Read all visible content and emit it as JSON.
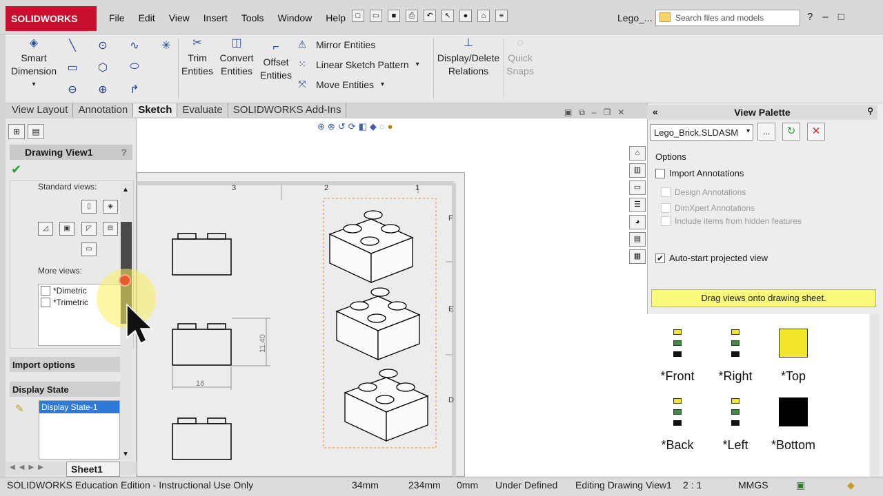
{
  "app": {
    "logo_text": "SOLIDWORKS",
    "doc_title": "Lego_..."
  },
  "menu": [
    "File",
    "Edit",
    "View",
    "Insert",
    "Tools",
    "Window",
    "Help"
  ],
  "search": {
    "placeholder": "Search files and models"
  },
  "ribbon": {
    "smart_dimension": "Smart Dimension",
    "trim_entities": "Trim Entities",
    "convert_entities": "Convert Entities",
    "offset_entities": "Offset Entities",
    "mirror_entities": "Mirror Entities",
    "linear_sketch_pattern": "Linear Sketch Pattern",
    "move_entities": "Move Entities",
    "display_delete_relations": "Display/Delete Relations",
    "quick_snaps": "Quick Snaps"
  },
  "tabs": [
    "View Layout",
    "Annotation",
    "Sketch",
    "Evaluate",
    "SOLIDWORKS Add-Ins"
  ],
  "active_tab": "Sketch",
  "property_manager": {
    "title": "Drawing View1",
    "help": "?",
    "standard_views_label": "Standard views:",
    "more_views_label": "More views:",
    "more_views": [
      "*Dimetric",
      "*Trimetric"
    ],
    "import_options": "Import options",
    "display_state_header": "Display State",
    "display_state_item": "Display State-1"
  },
  "sheet_tab": "Sheet1",
  "drawing": {
    "zone_numbers": [
      "3",
      "2",
      "1"
    ],
    "zone_letters": [
      "F",
      "E",
      "D"
    ],
    "dim_height": "11.40",
    "dim_width": "16"
  },
  "view_palette": {
    "title": "View Palette",
    "model": "Lego_Brick.SLDASM",
    "browse": "...",
    "options_label": "Options",
    "import_annotations": "Import Annotations",
    "design_annotations": "Design Annotations",
    "dimxpert_annotations": "DimXpert Annotations",
    "hidden_features": "Include items from hidden features",
    "auto_start": "Auto-start projected view",
    "drag_message": "Drag views onto drawing sheet.",
    "views": [
      "*Front",
      "*Right",
      "*Top",
      "*Back",
      "*Left",
      "*Bottom"
    ]
  },
  "status": {
    "edition": "SOLIDWORKS Education Edition - Instructional Use Only",
    "x": "34mm",
    "y": "234mm",
    "z": "0mm",
    "state": "Under Defined",
    "editing": "Editing Drawing View1",
    "scale": "2 : 1",
    "units": "MMGS"
  },
  "colors": {
    "brand": "#c8102e",
    "highlight": "#fafa7a",
    "selection": "#2f7ad8"
  }
}
